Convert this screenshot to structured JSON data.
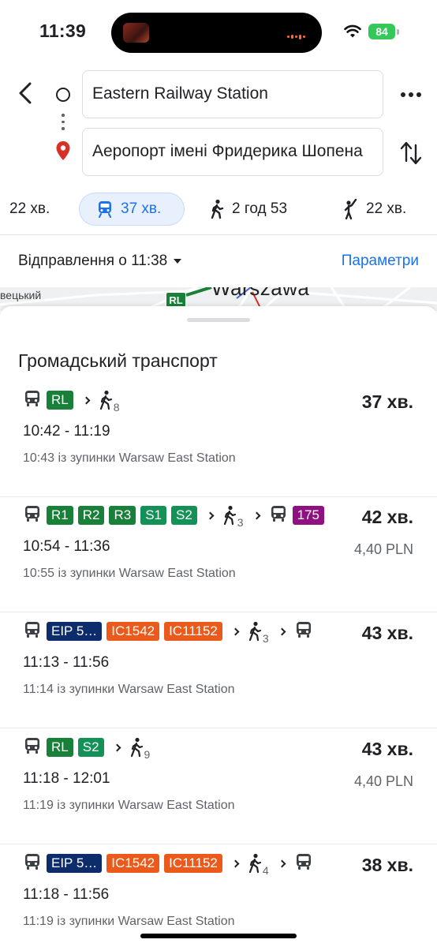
{
  "status": {
    "time": "11:39",
    "battery": "84"
  },
  "search": {
    "origin": "Eastern Railway Station",
    "destination": "Аеропорт імені Фридерика Шопена"
  },
  "modes": {
    "car": "22 хв.",
    "transit": "37 хв.",
    "walk": "2 год 53",
    "ride": "22 хв."
  },
  "departure": {
    "label": "Відправлення о 11:38",
    "options": "Параметри"
  },
  "map": {
    "left_label": "вецький",
    "city": "Warszawa",
    "line_badge": "RL"
  },
  "section_title": "Громадський транспорт",
  "routes": [
    {
      "lines": [
        {
          "text": "RL",
          "color": "#188038"
        }
      ],
      "walk_minutes": "8",
      "duration": "37 хв.",
      "times": "10:42 - 11:19",
      "price": "",
      "stop": "10:43 із зупинки Warsaw East Station"
    },
    {
      "lines": [
        {
          "text": "R1",
          "color": "#188038"
        },
        {
          "text": "R2",
          "color": "#188038"
        },
        {
          "text": "R3",
          "color": "#188038"
        },
        {
          "text": "S1",
          "color": "#139157"
        },
        {
          "text": "S2",
          "color": "#139157"
        }
      ],
      "walk_minutes": "3",
      "bus_line": {
        "text": "175",
        "color": "#8f117f"
      },
      "duration": "42 хв.",
      "times": "10:54 - 11:36",
      "price": "4,40 PLN",
      "stop": "10:55 із зупинки Warsaw East Station"
    },
    {
      "lines": [
        {
          "text": "EIP 5…",
          "color": "#0d2c6b"
        },
        {
          "text": "IC1542",
          "color": "#ec5a1b"
        },
        {
          "text": "IC11152",
          "color": "#ec5a1b"
        }
      ],
      "walk_minutes": "3",
      "duration": "43 хв.",
      "times": "11:13 - 11:56",
      "price": "",
      "stop": "11:14 із зупинки Warsaw East Station"
    },
    {
      "lines": [
        {
          "text": "RL",
          "color": "#188038"
        },
        {
          "text": "S2",
          "color": "#139157"
        }
      ],
      "walk_minutes": "9",
      "duration": "43 хв.",
      "times": "11:18 - 12:01",
      "price": "4,40 PLN",
      "stop": "11:19 із зупинки Warsaw East Station"
    },
    {
      "lines": [
        {
          "text": "EIP 5…",
          "color": "#0d2c6b"
        },
        {
          "text": "IC1542",
          "color": "#ec5a1b"
        },
        {
          "text": "IC11152",
          "color": "#ec5a1b"
        }
      ],
      "walk_minutes": "4",
      "duration": "38 хв.",
      "times": "11:18 - 11:56",
      "price": "",
      "stop": "11:19 із зупинки Warsaw East Station"
    }
  ]
}
